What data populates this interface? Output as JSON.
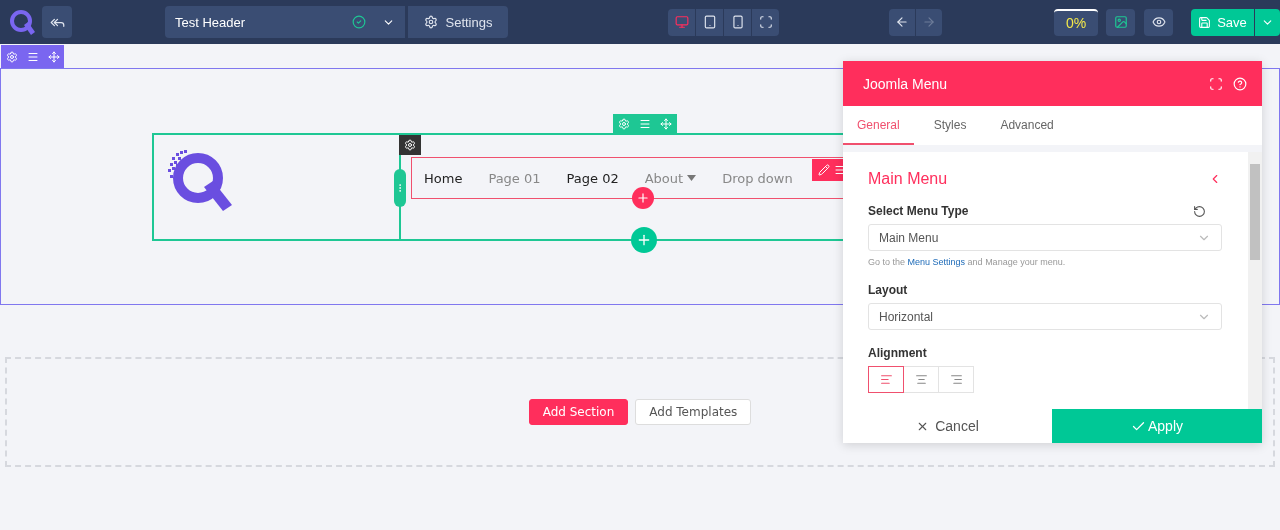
{
  "topbar": {
    "template_name": "Test Header",
    "settings_label": "Settings",
    "devices": [
      {
        "kind": "desktop",
        "selected": true
      },
      {
        "kind": "tablet",
        "selected": false
      },
      {
        "kind": "mobile",
        "selected": false
      },
      {
        "kind": "fullscreen",
        "selected": false
      }
    ],
    "history": [
      {
        "kind": "undo",
        "disabled": false
      },
      {
        "kind": "redo",
        "disabled": true
      }
    ],
    "progress": "0%",
    "save_label": "Save"
  },
  "canvas": {
    "menu_items": [
      {
        "label": "Home",
        "active": true,
        "has_dropdown": false
      },
      {
        "label": "Page 01",
        "active": false,
        "has_dropdown": false
      },
      {
        "label": "Page 02",
        "active": true,
        "has_dropdown": false
      },
      {
        "label": "About",
        "active": false,
        "has_dropdown": true
      },
      {
        "label": "Drop down",
        "active": false,
        "has_dropdown": false
      }
    ],
    "add_section": "Add Section",
    "add_templates": "Add Templates"
  },
  "panel": {
    "title": "Joomla Menu",
    "tabs": [
      {
        "label": "General",
        "selected": true
      },
      {
        "label": "Styles",
        "selected": false
      },
      {
        "label": "Advanced",
        "selected": false
      }
    ],
    "section_title": "Main Menu",
    "menu_type": {
      "label": "Select Menu Type",
      "value": "Main Menu"
    },
    "hint": {
      "before": "Go to the",
      "link": "Menu Settings",
      "after": "and Manage your menu."
    },
    "layout": {
      "label": "Layout",
      "value": "Horizontal"
    },
    "alignment": {
      "label": "Alignment",
      "options": [
        {
          "kind": "left",
          "selected": true
        },
        {
          "kind": "center",
          "selected": false
        },
        {
          "kind": "right",
          "selected": false
        }
      ]
    },
    "cancel": "Cancel",
    "apply": "Apply"
  }
}
